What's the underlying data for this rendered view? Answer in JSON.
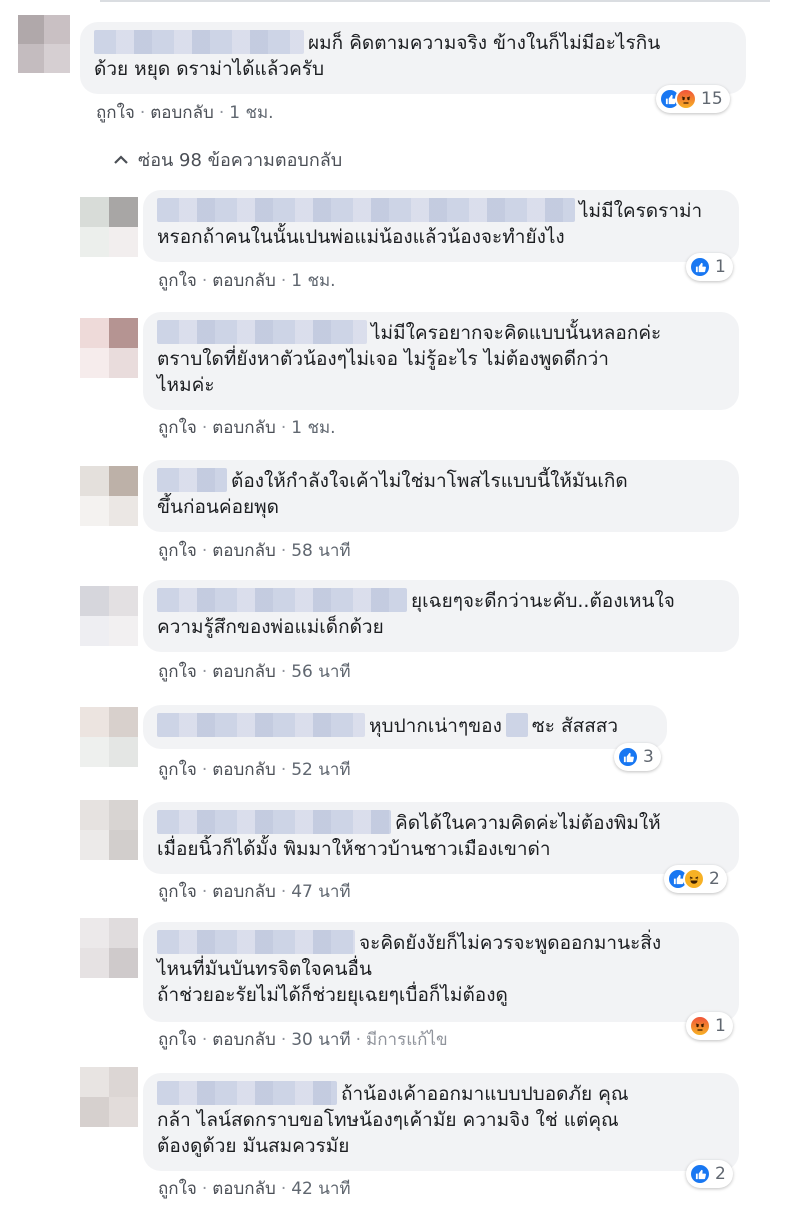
{
  "comments": [
    {
      "text": "ผมก็ คิดตามความจริง ข้างในก็ไม่มีอะไรกิน ด้วย หยุด ดราม่าได้แล้วครับ",
      "line1": "ผมก็ คิดตามความจริง ข้างในก็ไม่มีอะไรกิน",
      "line2": "ด้วย หยุด ดราม่าได้แล้วครับ",
      "like": "ถูกใจ",
      "reply": "ตอบกลับ",
      "time": "1 ชม.",
      "reactions": [
        "like",
        "angry"
      ],
      "count": "15",
      "avatar_colors": [
        "#b0a8aa",
        "#c9c0c3",
        "#c4bcbf",
        "#d6cfd2"
      ]
    },
    {
      "line1": "ไม่มีใครดราม่า",
      "line2": "หรอกถ้าคนในนั้นเปนพ่อแม่น้องแล้วน้องจะทำยังไง",
      "like": "ถูกใจ",
      "reply": "ตอบกลับ",
      "time": "1 ชม.",
      "reactions": [
        "like"
      ],
      "count": "1",
      "avatar_colors": [
        "#d8dcd8",
        "#a8a6a5",
        "#ecefec",
        "#f2eeee"
      ]
    },
    {
      "line1": "ไม่มีใครอยากจะคิดแบบนั้นหลอกค่ะ",
      "line2": "ตราบใดที่ยังหาตัวน้องๆไม่เจอ ไม่รู้อะไร ไม่ต้องพูดดีกว่า",
      "line3": "ไหมค่ะ",
      "like": "ถูกใจ",
      "reply": "ตอบกลับ",
      "time": "1 ชม.",
      "avatar_colors": [
        "#eedad9",
        "#b59492",
        "#f6ecec",
        "#e9dcdc"
      ]
    },
    {
      "line1": "ต้องให้กำลังใจเค้าไม่ใช่มาโพสไรแบบนี้ให้มันเกิด",
      "line2": "ขึ้นก่อนค่อยพุด",
      "like": "ถูกใจ",
      "reply": "ตอบกลับ",
      "time": "58 นาที",
      "avatar_colors": [
        "#e4e0dc",
        "#bdb1a8",
        "#f4f2f0",
        "#ebe7e4"
      ]
    },
    {
      "line1": "ยุเฉยๆจะดีกว่านะคับ..ต้องเหนใจ",
      "line2": "ความรู้สึกของพ่อแม่เด็กด้วย",
      "like": "ถูกใจ",
      "reply": "ตอบกลับ",
      "time": "56 นาที",
      "avatar_colors": [
        "#d6d6dc",
        "#e3e0e2",
        "#eeeef2",
        "#f2f0f1"
      ]
    },
    {
      "line1a": "หุบปากเน่าๆของ",
      "line1b": "ซะ สัสสสว",
      "like": "ถูกใจ",
      "reply": "ตอบกลับ",
      "time": "52 นาที",
      "reactions": [
        "like"
      ],
      "count": "3",
      "avatar_colors": [
        "#ece4e0",
        "#d8d0cc",
        "#eef0ee",
        "#e4e6e4"
      ]
    },
    {
      "line1": "คิดได้ในความคิดค่ะไม่ต้องพิมให้",
      "line2": "เมื่อยนิ้วก็ได้มั้ง พิมมาให้ชาวบ้านชาวเมืองเขาด่า",
      "like": "ถูกใจ",
      "reply": "ตอบกลับ",
      "time": "47 นาที",
      "reactions": [
        "like",
        "haha"
      ],
      "count": "2",
      "avatar_colors": [
        "#e6e2e0",
        "#d8d4d2",
        "#eceae9",
        "#d2cecc"
      ]
    },
    {
      "line1": "จะคิดยังงัยก็ไม่ควรจะพูดออกมานะสิ่ง",
      "line2": "ไหนที่มันบันทรจิตใจคนอื่น",
      "line3": "ถ้าช่วยอะรัยไม่ได้ก็ช่วยยุเฉยๆเบื่อก็ไม่ต้องดู",
      "like": "ถูกใจ",
      "reply": "ตอบกลับ",
      "time": "30 นาที",
      "edited": "มีการแก้ไข",
      "reactions": [
        "angry"
      ],
      "count": "1",
      "avatar_colors": [
        "#ece9ea",
        "#e0dcdd",
        "#e6e2e3",
        "#cfcacb"
      ]
    },
    {
      "line1": "ถ้าน้องเค้าออกมาแบบปบอดภัย คุณ",
      "line2": "กล้า ไลน์สดกราบขอโทษน้องๆเค้ามัย ความจิง ใช่ แต่คุณ",
      "line3": "ต้องดูด้วย มันสมควรมัย",
      "like": "ถูกใจ",
      "reply": "ตอบกลับ",
      "time": "42 นาที",
      "reactions": [
        "like"
      ],
      "count": "2",
      "avatar_colors": [
        "#e8e4e2",
        "#dcd6d4",
        "#d6d0ce",
        "#e2dcda"
      ]
    }
  ],
  "hide_replies_label": "ซ่อน 98 ข้อความตอบกลับ",
  "colors": {
    "bubble": "#f2f3f5",
    "link": "#4b4f56",
    "like_blue": "#1877f2"
  }
}
